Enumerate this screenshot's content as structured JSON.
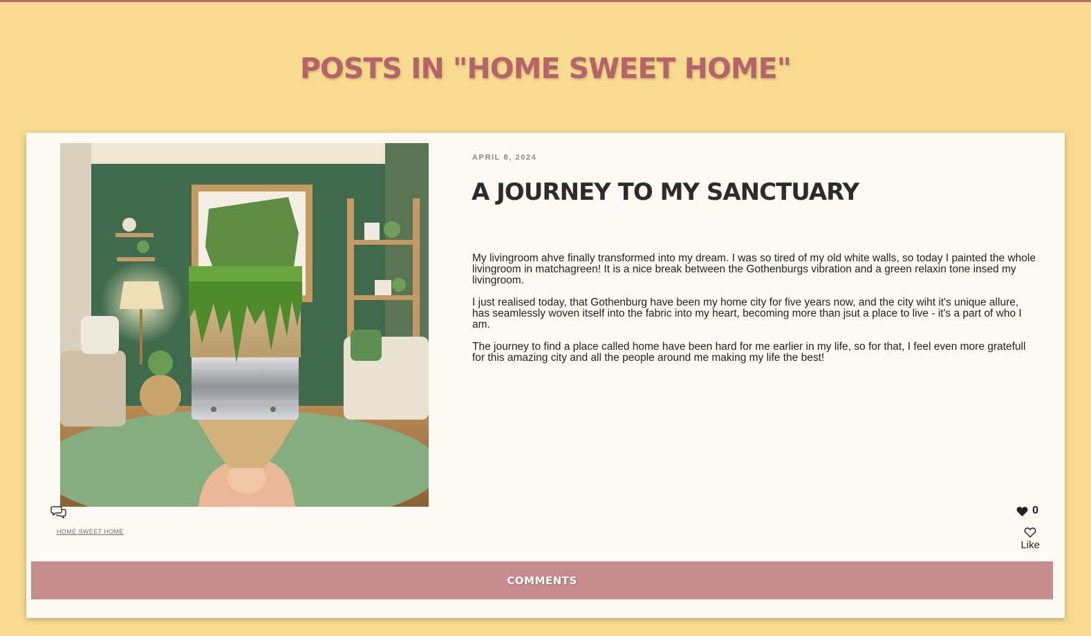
{
  "page": {
    "heading": "POSTS IN \"HOME SWEET HOME\""
  },
  "post": {
    "date": "APRIL 8, 2024",
    "title": "A JOURNEY TO MY SANCTUARY",
    "paragraphs": [
      "My livingroom ahve finally transformed into my dream. I was so tired of my old white walls, so today I painted the whole livingroom in matchagreen! It is a nice break between the Gothenburgs vibration and a green relaxin tone insed my livingroom.",
      "I just realised today, that Gothenburg have been my home city for five years now, and the city wiht it's unique allure, has seamlessly woven itself into the fabric into my heart, becoming more than jsut a place to live - it's a part of who I am.",
      "The journey to find a place called home have been hard for me earlier in my life, so for that, I feel even more gratefull for this amazing city and all the people around me making my life the best!"
    ],
    "category": "HOME SWEET HOME",
    "like_count": "0",
    "like_label": "Like",
    "comments_label": "COMMENTS",
    "icons": {
      "comment": "comment-bubbles-icon",
      "heart_filled": "heart-filled-icon",
      "heart_outline": "heart-outline-icon"
    }
  },
  "colors": {
    "background": "#f8db8e",
    "accent": "#b5646b",
    "card": "#fdfaf3",
    "comments_button": "#c88b8e"
  }
}
